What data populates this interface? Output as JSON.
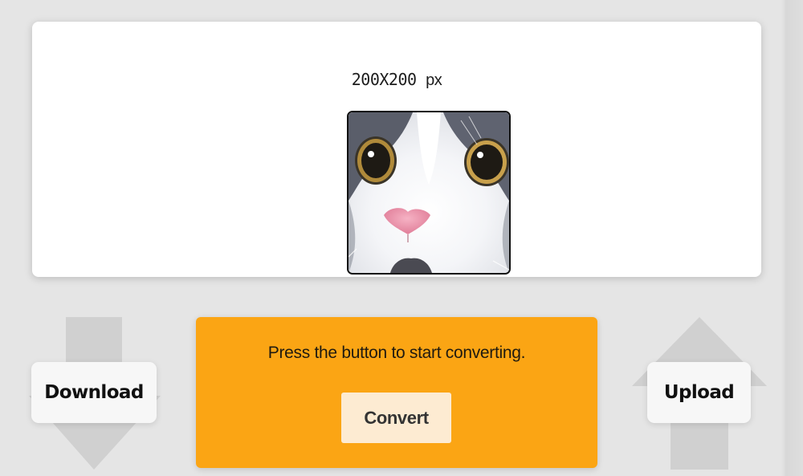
{
  "preview": {
    "size_value": "200X200",
    "size_unit": "px"
  },
  "actions": {
    "download_label": "Download",
    "upload_label": "Upload"
  },
  "converter": {
    "message": "Press the button to start converting.",
    "convert_label": "Convert"
  },
  "colors": {
    "background": "#e5e5e5",
    "card": "#ffffff",
    "panel_accent": "#fba514",
    "convert_button": "#fdebd2",
    "arrow_shape": "#d0d0d0"
  },
  "icons": {
    "download": "arrow-down-icon",
    "upload": "arrow-up-icon"
  }
}
